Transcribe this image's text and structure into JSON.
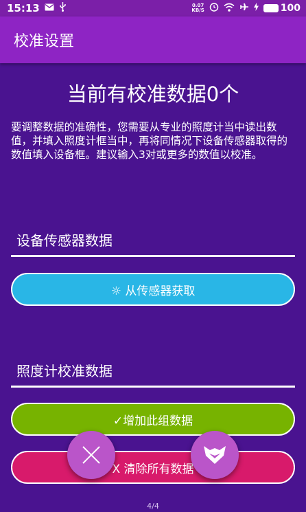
{
  "status_bar": {
    "time": "15:13",
    "net_speed_value": "0.07",
    "net_speed_unit": "KB/S",
    "battery": "100"
  },
  "app_bar": {
    "title": "校准设置"
  },
  "main": {
    "heading": "当前有校准数据0个",
    "description": "要调整数据的准确性，您需要从专业的照度计当中读出数值，并填入照度计框当中，再将同情况下设备传感器取得的数值填入设备框。建议输入3对或更多的数值以校准。",
    "sensor_field_label": "设备传感器数据",
    "sensor_button": "☼ 从传感器获取",
    "meter_field_label": "照度计校准数据",
    "add_button": "✓增加此组数据",
    "clear_button": "X 清除所有数据"
  },
  "page_indicator": "4/4",
  "icons": {
    "close": "close-icon",
    "mode": "fox-icon"
  },
  "colors": {
    "background": "#4a1390",
    "app_bar": "#8e24c4",
    "sensor_button": "#29b6e6",
    "add_button": "#77b300",
    "clear_button": "#d81a6b",
    "fab": "#ba55c9"
  }
}
